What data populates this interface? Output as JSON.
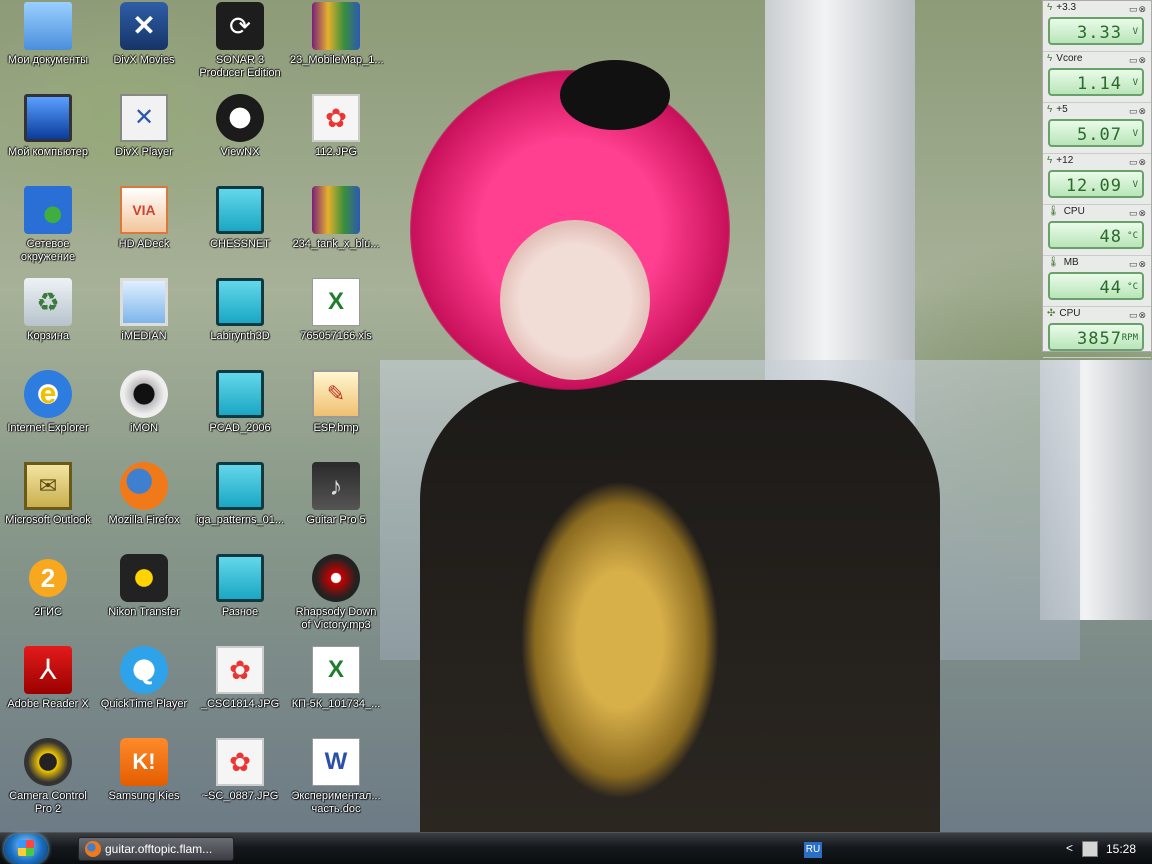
{
  "desktop": {
    "icons": [
      {
        "label": "Мои документы",
        "icon": "my-documents-icon"
      },
      {
        "label": "DivX Movies",
        "icon": "divx-movies-icon"
      },
      {
        "label": "SONAR 3 Producer Edition",
        "icon": "sonar-icon"
      },
      {
        "label": "23_MobileMap_1...",
        "icon": "rar-archive-icon"
      },
      {
        "label": "Мой компьютер",
        "icon": "my-computer-icon"
      },
      {
        "label": "DivX Player",
        "icon": "divx-player-icon"
      },
      {
        "label": "ViewNX",
        "icon": "viewnx-icon"
      },
      {
        "label": "112.JPG",
        "icon": "jpg-file-icon"
      },
      {
        "label": "Сетевое окружение",
        "icon": "network-places-icon"
      },
      {
        "label": "HD ADeck",
        "icon": "via-hd-adeck-icon"
      },
      {
        "label": "CHESSNET",
        "icon": "shortcut-cyan-icon"
      },
      {
        "label": "234_tank_x_blu...",
        "icon": "rar-archive-icon"
      },
      {
        "label": "Корзина",
        "icon": "recycle-bin-icon"
      },
      {
        "label": "iMEDIAN",
        "icon": "imedian-icon"
      },
      {
        "label": "Labirynth3D",
        "icon": "shortcut-cyan-icon"
      },
      {
        "label": "765057166.xls",
        "icon": "excel-file-icon"
      },
      {
        "label": "Internet Explorer",
        "icon": "internet-explorer-icon"
      },
      {
        "label": "iMON",
        "icon": "imon-icon"
      },
      {
        "label": "PCAD_2006",
        "icon": "shortcut-cyan-icon"
      },
      {
        "label": "ESP.bmp",
        "icon": "bmp-file-icon"
      },
      {
        "label": "Microsoft Outlook",
        "icon": "outlook-icon"
      },
      {
        "label": "Mozilla Firefox",
        "icon": "firefox-icon"
      },
      {
        "label": "iga_patterns_01...",
        "icon": "shortcut-cyan-icon"
      },
      {
        "label": "Guitar Pro 5",
        "icon": "guitar-pro-icon"
      },
      {
        "label": "2ГИС",
        "icon": "2gis-icon"
      },
      {
        "label": "Nikon Transfer",
        "icon": "nikon-transfer-icon"
      },
      {
        "label": "Разное",
        "icon": "shortcut-cyan-icon"
      },
      {
        "label": "Rhapsody Down of Victory.mp3",
        "icon": "mp3-file-icon"
      },
      {
        "label": "Adobe Reader X",
        "icon": "adobe-reader-icon"
      },
      {
        "label": "QuickTime Player",
        "icon": "quicktime-icon"
      },
      {
        "label": "_CSC1814.JPG",
        "icon": "jpg-file-icon"
      },
      {
        "label": "КП-5К_101734_...",
        "icon": "excel-file-icon"
      },
      {
        "label": "Camera Control Pro 2",
        "icon": "camera-control-icon"
      },
      {
        "label": "Samsung Kies",
        "icon": "samsung-kies-icon"
      },
      {
        "label": "~SC_0887.JPG",
        "icon": "jpg-file-icon"
      },
      {
        "label": "Экспериментал... часть.doc",
        "icon": "word-file-icon"
      }
    ]
  },
  "sensors": [
    {
      "name": "+3.3",
      "value": "3.33",
      "unit": "V"
    },
    {
      "name": "Vcore",
      "value": "1.14",
      "unit": "V"
    },
    {
      "name": "+5",
      "value": "5.07",
      "unit": "V"
    },
    {
      "name": "+12",
      "value": "12.09",
      "unit": "V"
    },
    {
      "name": "CPU",
      "value": "48",
      "unit": "°C"
    },
    {
      "name": "MB",
      "value": "44",
      "unit": "°C"
    },
    {
      "name": "CPU",
      "value": "3857",
      "unit": "RPM"
    }
  ],
  "taskbar": {
    "window_title": "guitar.offtopic.flam...",
    "language": "RU",
    "clock": "15:28"
  }
}
